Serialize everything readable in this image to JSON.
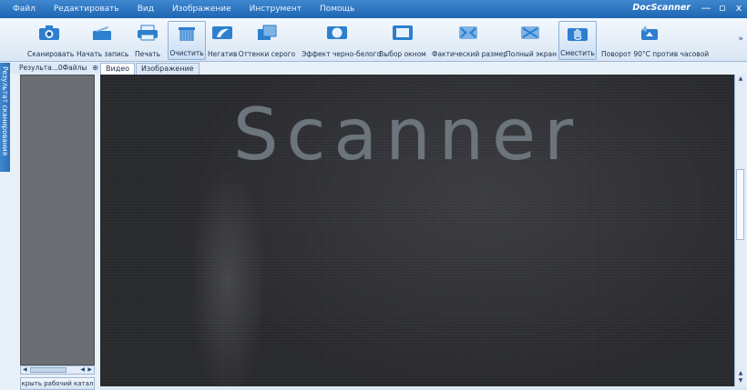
{
  "menu": {
    "items": [
      "Файл",
      "Редактировать",
      "Вид",
      "Изображение",
      "Инструмент",
      "Помощь"
    ],
    "app_name": "DocScanner"
  },
  "window_controls": {
    "minimize": "—",
    "restore": "▫",
    "close": "x"
  },
  "toolbar": {
    "tools": [
      {
        "label": "Сканировать",
        "icon": "camera-icon"
      },
      {
        "label": "Начать запись",
        "icon": "record-icon"
      },
      {
        "label": "Печать",
        "icon": "printer-icon"
      },
      {
        "label": "Очистить",
        "icon": "broom-icon"
      },
      {
        "label": "Негатив",
        "icon": "negative-icon"
      },
      {
        "label": "Оттенки серого",
        "icon": "grayscale-icon"
      },
      {
        "label": "Эффект черно-белого",
        "icon": "bw-effect-icon"
      },
      {
        "label": "Выбор окном",
        "icon": "window-select-icon"
      },
      {
        "label": "Фактический размер",
        "icon": "actual-size-icon"
      },
      {
        "label": "Полный экран",
        "icon": "fullscreen-icon"
      },
      {
        "label": "Сместить",
        "icon": "hand-icon"
      },
      {
        "label": "Поворот 90°С против часовой",
        "icon": "rotate-ccw-icon"
      }
    ],
    "active_tools": [
      "Очистить",
      "Сместить"
    ],
    "more": "»"
  },
  "left_panel": {
    "vertical_tab": "Результат сканирования",
    "header": "Результа...0Файлы",
    "pin": "⊕",
    "open_dir_button": "крыть рабочий катал"
  },
  "content_tabs": [
    "Видео",
    "Изображение"
  ],
  "viewer": {
    "overlay_text": "Scanner"
  },
  "colors": {
    "menubar": "#2a74c0",
    "toolbar": "#e2ecf7",
    "viewer_bg": "#2d2e32"
  }
}
